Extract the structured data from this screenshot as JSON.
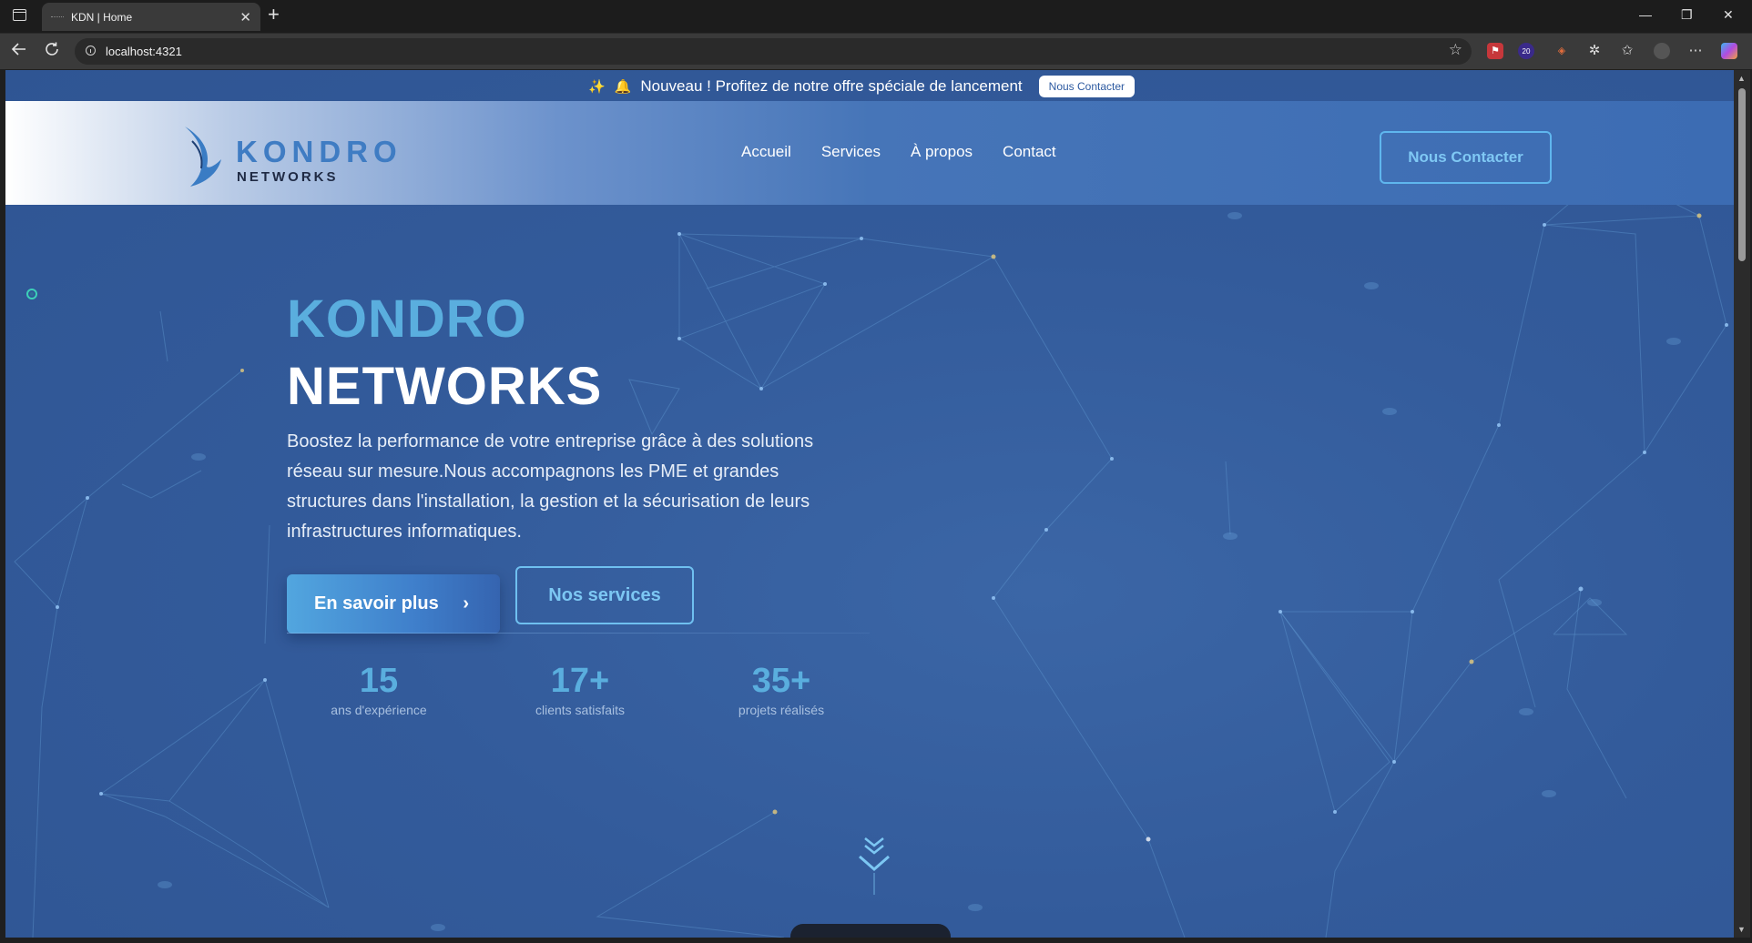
{
  "browser": {
    "tab_title": "KDN | Home",
    "tab_close": "✕",
    "new_tab": "+",
    "url": "localhost:4321",
    "extension_badge": "20",
    "window_controls": {
      "minimize": "—",
      "restore": "❐",
      "close": "✕"
    }
  },
  "announcement": {
    "text": "Nouveau ! Profitez de notre offre spéciale de lancement",
    "button": "Nous Contacter"
  },
  "header": {
    "logo": {
      "line1": "KONDRO",
      "line2": "NETWORKS"
    },
    "menu": [
      "Accueil",
      "Services",
      "À propos",
      "Contact"
    ],
    "cta": "Nous Contacter"
  },
  "hero": {
    "title_line1": "KONDRO",
    "title_line2": "NETWORKS",
    "description": "Boostez la performance de votre entreprise grâce à des solutions réseau sur mesure.Nous accompagnons les PME et grandes structures dans l'installation, la gestion et la sécurisation de leurs infrastructures informatiques.",
    "primary_button": "En savoir plus",
    "secondary_button": "Nos services"
  },
  "stats": [
    {
      "value": "15",
      "label": "ans d'expérience"
    },
    {
      "value": "17+",
      "label": "clients satisfaits"
    },
    {
      "value": "35+",
      "label": "projets réalisés"
    }
  ],
  "colors": {
    "accent": "#5aaede",
    "background": "#335b9b",
    "header_fade": "#ffffff",
    "chrome": "#1c1c1c"
  },
  "icons": [
    "window-icon",
    "back-arrow-icon",
    "reload-icon",
    "info-icon",
    "star-icon",
    "sparkle-icon",
    "bell-icon",
    "chevron-right-icon",
    "scroll-down-icon"
  ]
}
